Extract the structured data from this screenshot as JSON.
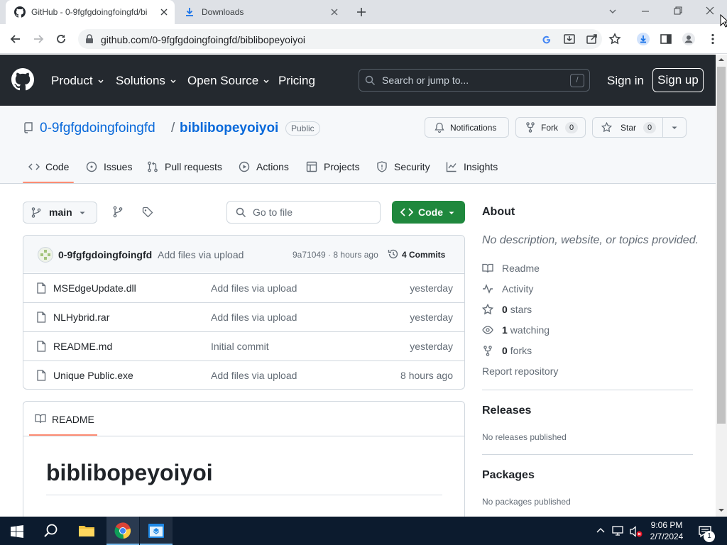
{
  "browser": {
    "tabs": [
      {
        "title": "GitHub - 0-9fgfgdoingfoingfd/bi",
        "active": true
      },
      {
        "title": "Downloads",
        "active": false
      }
    ],
    "url": "github.com/0-9fgfgdoingfoingfd/biblibopeyoiyoi"
  },
  "gh_header": {
    "nav": [
      "Product",
      "Solutions",
      "Open Source",
      "Pricing"
    ],
    "search_placeholder": "Search or jump to...",
    "slash_key": "/",
    "sign_in": "Sign in",
    "sign_up": "Sign up"
  },
  "repo": {
    "owner": "0-9fgfgdoingfoingfd",
    "separator": "/",
    "name": "biblibopeyoiyoi",
    "visibility": "Public",
    "notifications_label": "Notifications",
    "fork_label": "Fork",
    "fork_count": "0",
    "star_label": "Star",
    "star_count": "0",
    "tabs": [
      "Code",
      "Issues",
      "Pull requests",
      "Actions",
      "Projects",
      "Security",
      "Insights"
    ]
  },
  "filebar": {
    "branch": "main",
    "go_to_file": "Go to file",
    "code_button": "Code"
  },
  "commit": {
    "author": "0-9fgfgdoingfoingfd",
    "message": "Add files via upload",
    "hash_time": "9a71049 · 8 hours ago",
    "commits": "4 Commits"
  },
  "files": [
    {
      "name": "MSEdgeUpdate.dll",
      "message": "Add files via upload",
      "date": "yesterday"
    },
    {
      "name": "NLHybrid.rar",
      "message": "Add files via upload",
      "date": "yesterday"
    },
    {
      "name": "README.md",
      "message": "Initial commit",
      "date": "yesterday"
    },
    {
      "name": "Unique Public.exe",
      "message": "Add files via upload",
      "date": "8 hours ago"
    }
  ],
  "readme": {
    "tab": "README",
    "heading": "biblibopeyoiyoi"
  },
  "about": {
    "title": "About",
    "description": "No description, website, or topics provided.",
    "readme": "Readme",
    "activity": "Activity",
    "stars_count": "0",
    "stars_label": "stars",
    "watching_count": "1",
    "watching_label": "watching",
    "forks_count": "0",
    "forks_label": "forks",
    "report": "Report repository"
  },
  "releases": {
    "title": "Releases",
    "text": "No releases published"
  },
  "packages": {
    "title": "Packages",
    "text": "No packages published"
  },
  "taskbar": {
    "time": "9:06 PM",
    "date": "2/7/2024",
    "notifications": "1"
  },
  "colors": {
    "accent_green": "#1f883d",
    "link_blue": "#0969da",
    "header_dark": "#24292f"
  }
}
